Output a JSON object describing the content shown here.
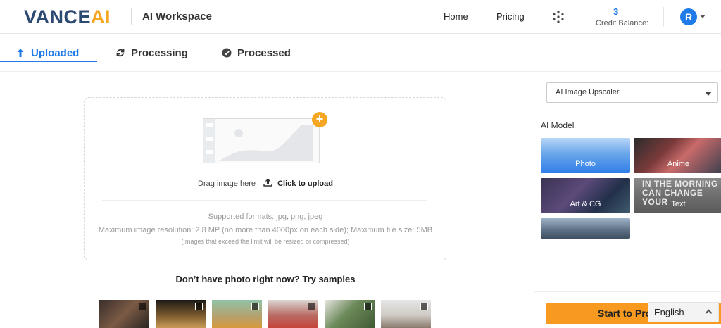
{
  "header": {
    "logo_main": "VANCE",
    "logo_ai": "AI",
    "workspace": "AI Workspace",
    "nav": {
      "home": "Home",
      "pricing": "Pricing"
    },
    "credit": {
      "value": "3",
      "label": "Credit Balance:"
    },
    "avatar_initial": "R",
    "colors": {
      "brand_dark": "#2d4a73",
      "brand_orange": "#f5a623",
      "accent_blue": "#1e7be8"
    }
  },
  "tabs": [
    {
      "label": "Uploaded",
      "icon": "upload-arrow-icon",
      "active": true
    },
    {
      "label": "Processing",
      "icon": "refresh-icon",
      "active": false
    },
    {
      "label": "Processed",
      "icon": "check-circle-icon",
      "active": false
    }
  ],
  "upload": {
    "drag_text": "Drag image here",
    "click_text": "Click to upload",
    "formats": "Supported formats: jpg, png, jpeg",
    "limits": "Maximum image resolution: 2.8 MP (no more than 4000px on each side); Maximum file size: 5MB",
    "note": "(Images that exceed the limit will be resized or compressed)"
  },
  "samples": {
    "title": "Don’t have photo right now? Try samples",
    "items": [
      "sample-portrait",
      "sample-building",
      "sample-tiger",
      "sample-woman",
      "sample-plant",
      "sample-cat"
    ]
  },
  "panel": {
    "tool_select": "AI Image Upscaler",
    "model_title": "AI Model",
    "models": [
      {
        "label": "Photo"
      },
      {
        "label": "Anime"
      },
      {
        "label": "Art & CG"
      },
      {
        "label": "Text",
        "image_text": "IN THE MORNING CAN CHANGE YOUR"
      }
    ],
    "start_button": "Start to Process",
    "start_color": "#f79a1f"
  },
  "language": {
    "selected": "English"
  }
}
